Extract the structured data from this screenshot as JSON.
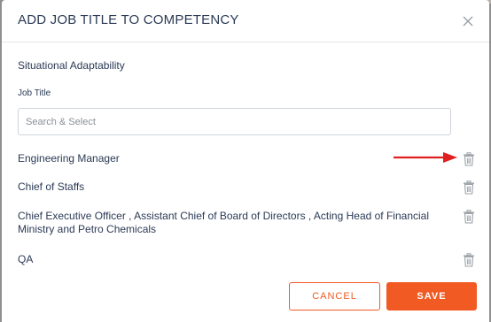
{
  "modal": {
    "title": "ADD JOB TITLE TO COMPETENCY",
    "competency": "Situational Adaptability",
    "job_title_label": "Job Title",
    "search_placeholder": "Search & Select"
  },
  "job_titles": [
    {
      "label": "Engineering Manager",
      "icon": "trash-icon"
    },
    {
      "label": "Chief of Staffs",
      "icon": "trash-icon"
    },
    {
      "label": "Chief Executive Officer , Assistant Chief of Board of Directors , Acting Head of Financial Ministry and Petro Chemicals",
      "icon": "trash-icon"
    },
    {
      "label": "QA",
      "icon": "trash-icon"
    }
  ],
  "buttons": {
    "cancel": "CANCEL",
    "save": "SAVE"
  },
  "colors": {
    "accent": "#f15a22",
    "text": "#2b3a55",
    "arrow": "#e02020",
    "icon": "#9aa0a6"
  }
}
